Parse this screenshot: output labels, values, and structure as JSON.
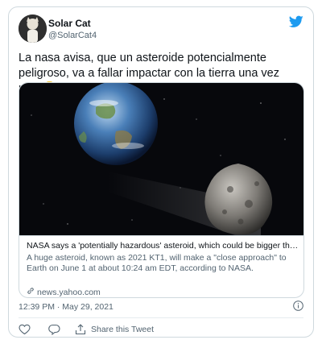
{
  "user": {
    "name": "Solar Cat",
    "handle": "@SolarCat4"
  },
  "tweet": {
    "text": "La nasa avisa, que un asteroide potencialmente peligroso, va a fallar impactar con la tierra una vez más",
    "emoji": "relieved-face"
  },
  "link_card": {
    "title": "NASA says a 'potentially hazardous' asteroid, which could be bigger tha...",
    "description": "A huge asteroid, known as 2021 KT1, will make a \"close approach\" to Earth on June 1 at about 10:24 am EDT, according to NASA.",
    "domain": "news.yahoo.com"
  },
  "timestamp": "12:39 PM · May 29, 2021",
  "actions": {
    "share_label": "Share this Tweet"
  },
  "colors": {
    "twitter_blue": "#1d9bf0",
    "secondary_text": "#536471",
    "border": "#cfd9de"
  }
}
